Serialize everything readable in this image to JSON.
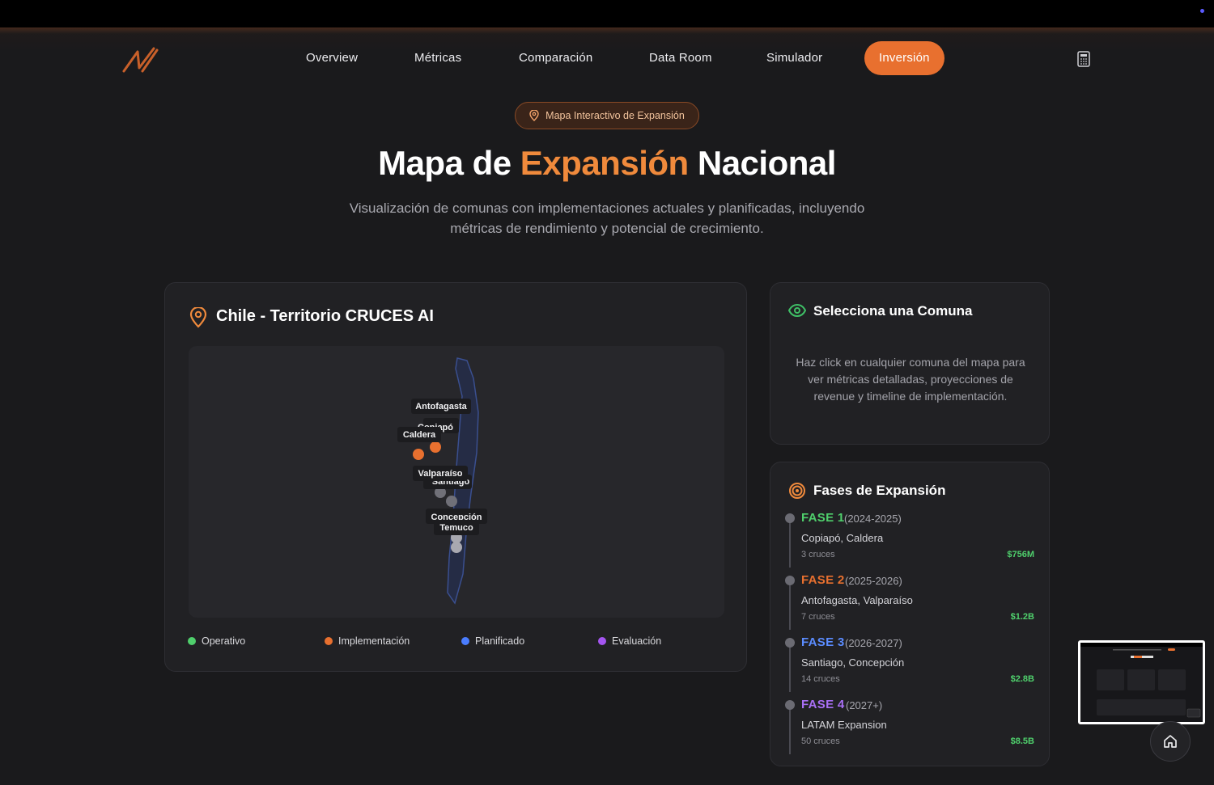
{
  "nav": {
    "items": [
      "Overview",
      "Métricas",
      "Comparación",
      "Data Room",
      "Simulador"
    ],
    "active": "Inversión",
    "accent_color": "#e8702f"
  },
  "hero": {
    "badge": "Mapa Interactivo de Expansión",
    "title_before": "Mapa de ",
    "title_accent": "Expansión",
    "title_after": " Nacional",
    "subtitle": "Visualización de comunas con implementaciones actuales y planificadas, incluyendo métricas de rendimiento y potencial de crecimiento."
  },
  "map": {
    "title": "Chile - Territorio CRUCES AI",
    "labels": {
      "antofagasta": "Antofagasta",
      "copiapo": "Copiapó",
      "caldera": "Caldera",
      "valparaiso": "Valparaíso",
      "santiago": "Santiago",
      "concepcion": "Concepción",
      "temuco": "Temuco"
    },
    "legend": [
      {
        "label": "Operativo",
        "color": "#4fcf6c"
      },
      {
        "label": "Implementación",
        "color": "#e8702f"
      },
      {
        "label": "Planificado",
        "color": "#4a7dff"
      },
      {
        "label": "Evaluación",
        "color": "#a455f0"
      }
    ]
  },
  "select": {
    "title": "Selecciona una Comuna",
    "description": "Haz click en cualquier comuna del mapa para ver métricas detalladas, proyecciones de revenue y timeline de implementación."
  },
  "phases": {
    "title": "Fases de Expansión",
    "items": [
      {
        "name": "FASE 1",
        "years": "(2024-2025)",
        "cities": "Copiapó, Caldera",
        "count": "3 cruces",
        "amount": "$756M",
        "color": "#4fcf6c"
      },
      {
        "name": "FASE 2",
        "years": "(2025-2026)",
        "cities": "Antofagasta, Valparaíso",
        "count": "7 cruces",
        "amount": "$1.2B",
        "color": "#e8702f"
      },
      {
        "name": "FASE 3",
        "years": "(2026-2027)",
        "cities": "Santiago, Concepción",
        "count": "14 cruces",
        "amount": "$2.8B",
        "color": "#5b8cff"
      },
      {
        "name": "FASE 4",
        "years": "(2027+)",
        "cities": "LATAM Expansion",
        "count": "50 cruces",
        "amount": "$8.5B",
        "color": "#a970f5"
      }
    ]
  }
}
